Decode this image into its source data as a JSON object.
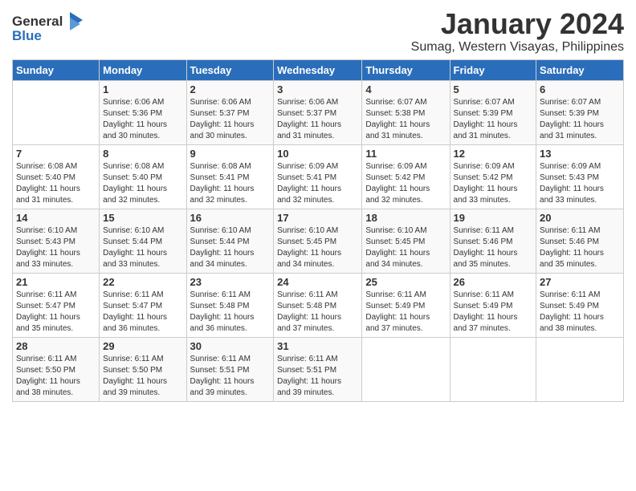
{
  "logo": {
    "text_general": "General",
    "text_blue": "Blue"
  },
  "title": "January 2024",
  "subtitle": "Sumag, Western Visayas, Philippines",
  "header": {
    "days": [
      "Sunday",
      "Monday",
      "Tuesday",
      "Wednesday",
      "Thursday",
      "Friday",
      "Saturday"
    ]
  },
  "weeks": [
    [
      {
        "day": "",
        "sunrise": "",
        "sunset": "",
        "daylight": ""
      },
      {
        "day": "1",
        "sunrise": "Sunrise: 6:06 AM",
        "sunset": "Sunset: 5:36 PM",
        "daylight": "Daylight: 11 hours and 30 minutes."
      },
      {
        "day": "2",
        "sunrise": "Sunrise: 6:06 AM",
        "sunset": "Sunset: 5:37 PM",
        "daylight": "Daylight: 11 hours and 30 minutes."
      },
      {
        "day": "3",
        "sunrise": "Sunrise: 6:06 AM",
        "sunset": "Sunset: 5:37 PM",
        "daylight": "Daylight: 11 hours and 31 minutes."
      },
      {
        "day": "4",
        "sunrise": "Sunrise: 6:07 AM",
        "sunset": "Sunset: 5:38 PM",
        "daylight": "Daylight: 11 hours and 31 minutes."
      },
      {
        "day": "5",
        "sunrise": "Sunrise: 6:07 AM",
        "sunset": "Sunset: 5:39 PM",
        "daylight": "Daylight: 11 hours and 31 minutes."
      },
      {
        "day": "6",
        "sunrise": "Sunrise: 6:07 AM",
        "sunset": "Sunset: 5:39 PM",
        "daylight": "Daylight: 11 hours and 31 minutes."
      }
    ],
    [
      {
        "day": "7",
        "sunrise": "Sunrise: 6:08 AM",
        "sunset": "Sunset: 5:40 PM",
        "daylight": "Daylight: 11 hours and 31 minutes."
      },
      {
        "day": "8",
        "sunrise": "Sunrise: 6:08 AM",
        "sunset": "Sunset: 5:40 PM",
        "daylight": "Daylight: 11 hours and 32 minutes."
      },
      {
        "day": "9",
        "sunrise": "Sunrise: 6:08 AM",
        "sunset": "Sunset: 5:41 PM",
        "daylight": "Daylight: 11 hours and 32 minutes."
      },
      {
        "day": "10",
        "sunrise": "Sunrise: 6:09 AM",
        "sunset": "Sunset: 5:41 PM",
        "daylight": "Daylight: 11 hours and 32 minutes."
      },
      {
        "day": "11",
        "sunrise": "Sunrise: 6:09 AM",
        "sunset": "Sunset: 5:42 PM",
        "daylight": "Daylight: 11 hours and 32 minutes."
      },
      {
        "day": "12",
        "sunrise": "Sunrise: 6:09 AM",
        "sunset": "Sunset: 5:42 PM",
        "daylight": "Daylight: 11 hours and 33 minutes."
      },
      {
        "day": "13",
        "sunrise": "Sunrise: 6:09 AM",
        "sunset": "Sunset: 5:43 PM",
        "daylight": "Daylight: 11 hours and 33 minutes."
      }
    ],
    [
      {
        "day": "14",
        "sunrise": "Sunrise: 6:10 AM",
        "sunset": "Sunset: 5:43 PM",
        "daylight": "Daylight: 11 hours and 33 minutes."
      },
      {
        "day": "15",
        "sunrise": "Sunrise: 6:10 AM",
        "sunset": "Sunset: 5:44 PM",
        "daylight": "Daylight: 11 hours and 33 minutes."
      },
      {
        "day": "16",
        "sunrise": "Sunrise: 6:10 AM",
        "sunset": "Sunset: 5:44 PM",
        "daylight": "Daylight: 11 hours and 34 minutes."
      },
      {
        "day": "17",
        "sunrise": "Sunrise: 6:10 AM",
        "sunset": "Sunset: 5:45 PM",
        "daylight": "Daylight: 11 hours and 34 minutes."
      },
      {
        "day": "18",
        "sunrise": "Sunrise: 6:10 AM",
        "sunset": "Sunset: 5:45 PM",
        "daylight": "Daylight: 11 hours and 34 minutes."
      },
      {
        "day": "19",
        "sunrise": "Sunrise: 6:11 AM",
        "sunset": "Sunset: 5:46 PM",
        "daylight": "Daylight: 11 hours and 35 minutes."
      },
      {
        "day": "20",
        "sunrise": "Sunrise: 6:11 AM",
        "sunset": "Sunset: 5:46 PM",
        "daylight": "Daylight: 11 hours and 35 minutes."
      }
    ],
    [
      {
        "day": "21",
        "sunrise": "Sunrise: 6:11 AM",
        "sunset": "Sunset: 5:47 PM",
        "daylight": "Daylight: 11 hours and 35 minutes."
      },
      {
        "day": "22",
        "sunrise": "Sunrise: 6:11 AM",
        "sunset": "Sunset: 5:47 PM",
        "daylight": "Daylight: 11 hours and 36 minutes."
      },
      {
        "day": "23",
        "sunrise": "Sunrise: 6:11 AM",
        "sunset": "Sunset: 5:48 PM",
        "daylight": "Daylight: 11 hours and 36 minutes."
      },
      {
        "day": "24",
        "sunrise": "Sunrise: 6:11 AM",
        "sunset": "Sunset: 5:48 PM",
        "daylight": "Daylight: 11 hours and 37 minutes."
      },
      {
        "day": "25",
        "sunrise": "Sunrise: 6:11 AM",
        "sunset": "Sunset: 5:49 PM",
        "daylight": "Daylight: 11 hours and 37 minutes."
      },
      {
        "day": "26",
        "sunrise": "Sunrise: 6:11 AM",
        "sunset": "Sunset: 5:49 PM",
        "daylight": "Daylight: 11 hours and 37 minutes."
      },
      {
        "day": "27",
        "sunrise": "Sunrise: 6:11 AM",
        "sunset": "Sunset: 5:49 PM",
        "daylight": "Daylight: 11 hours and 38 minutes."
      }
    ],
    [
      {
        "day": "28",
        "sunrise": "Sunrise: 6:11 AM",
        "sunset": "Sunset: 5:50 PM",
        "daylight": "Daylight: 11 hours and 38 minutes."
      },
      {
        "day": "29",
        "sunrise": "Sunrise: 6:11 AM",
        "sunset": "Sunset: 5:50 PM",
        "daylight": "Daylight: 11 hours and 39 minutes."
      },
      {
        "day": "30",
        "sunrise": "Sunrise: 6:11 AM",
        "sunset": "Sunset: 5:51 PM",
        "daylight": "Daylight: 11 hours and 39 minutes."
      },
      {
        "day": "31",
        "sunrise": "Sunrise: 6:11 AM",
        "sunset": "Sunset: 5:51 PM",
        "daylight": "Daylight: 11 hours and 39 minutes."
      },
      {
        "day": "",
        "sunrise": "",
        "sunset": "",
        "daylight": ""
      },
      {
        "day": "",
        "sunrise": "",
        "sunset": "",
        "daylight": ""
      },
      {
        "day": "",
        "sunrise": "",
        "sunset": "",
        "daylight": ""
      }
    ]
  ]
}
